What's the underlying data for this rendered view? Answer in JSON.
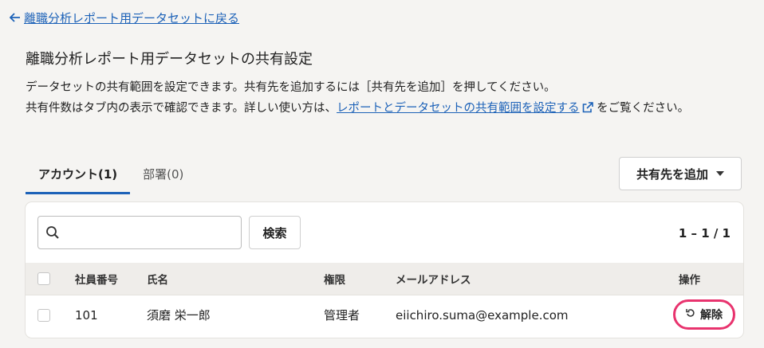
{
  "nav": {
    "back_label": "離職分析レポート用データセットに戻る"
  },
  "page": {
    "title": "離職分析レポート用データセットの共有設定"
  },
  "description": {
    "line1": "データセットの共有範囲を設定できます。共有先を追加するには［共有先を追加］を押してください。",
    "line2_before": "共有件数はタブ内の表示で確認できます。詳しい使い方は、",
    "line2_link": "レポートとデータセットの共有範囲を設定する",
    "line2_after": "をご覧ください。"
  },
  "tabs": [
    {
      "label": "アカウント(1)",
      "active": true
    },
    {
      "label": "部署(0)",
      "active": false
    }
  ],
  "add_button": {
    "label": "共有先を追加",
    "icon": "caret-down-icon"
  },
  "search": {
    "value": "",
    "placeholder": "",
    "button_label": "検索",
    "icon": "search-icon"
  },
  "pagination": {
    "label": "1 – 1 / 1"
  },
  "table": {
    "headers": {
      "employee_no": "社員番号",
      "name": "氏名",
      "role": "権限",
      "email": "メールアドレス",
      "action": "操作"
    },
    "rows": [
      {
        "employee_no": "101",
        "name": "須磨 栄一郎",
        "role": "管理者",
        "email": "eiichiro.suma@example.com",
        "action_label": "解除"
      }
    ]
  },
  "colors": {
    "link": "#1d62b8",
    "highlight": "#e8336e",
    "header_bg": "#efedea",
    "page_bg": "#f5f4f2"
  }
}
